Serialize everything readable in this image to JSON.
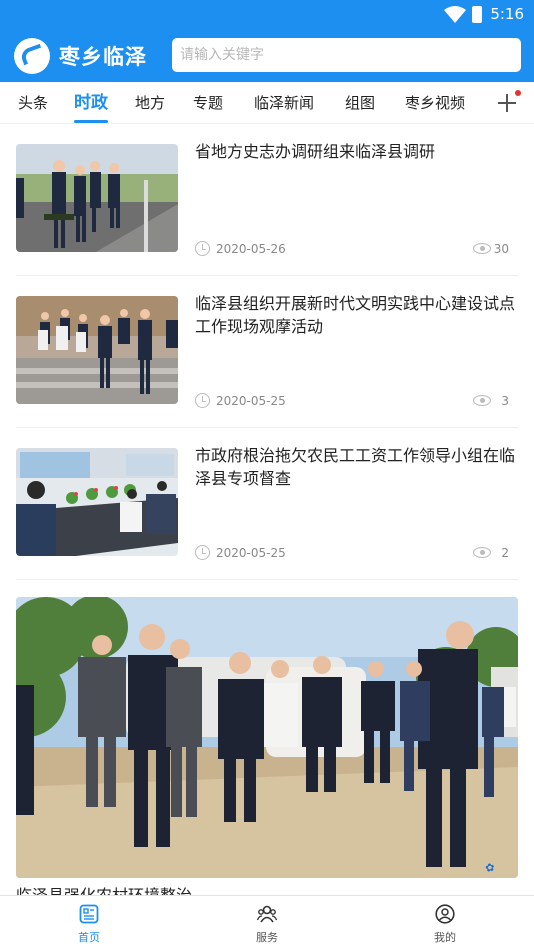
{
  "status_bar": {
    "time": "5:16"
  },
  "header": {
    "app_name": "枣乡临泽",
    "search_placeholder": "请输入关键字"
  },
  "tabs": [
    {
      "label": "头条",
      "active": false
    },
    {
      "label": "时政",
      "active": true
    },
    {
      "label": "地方",
      "active": false
    },
    {
      "label": "专题",
      "active": false
    },
    {
      "label": "临泽新闻",
      "active": false
    },
    {
      "label": "组图",
      "active": false
    },
    {
      "label": "枣乡视频",
      "active": false
    }
  ],
  "news": [
    {
      "title": "省地方史志办调研组来临泽县调研",
      "date": "2020-05-26",
      "views": "30"
    },
    {
      "title": "临泽县组织开展新时代文明实践中心建设试点工作现场观摩活动",
      "date": "2020-05-25",
      "views": "3"
    },
    {
      "title": "市政府根治拖欠农民工工资工作领导小组在临泽县专项督查",
      "date": "2020-05-25",
      "views": "2"
    }
  ],
  "featured": {
    "title": "临泽县强化农村环境整治……"
  },
  "bottom_nav": [
    {
      "label": "首页",
      "icon": "home-icon",
      "active": true
    },
    {
      "label": "服务",
      "icon": "service-icon",
      "active": false
    },
    {
      "label": "我的",
      "icon": "profile-icon",
      "active": false
    }
  ],
  "colors": {
    "brand": "#1c8ff0",
    "badge": "#e8312f"
  }
}
